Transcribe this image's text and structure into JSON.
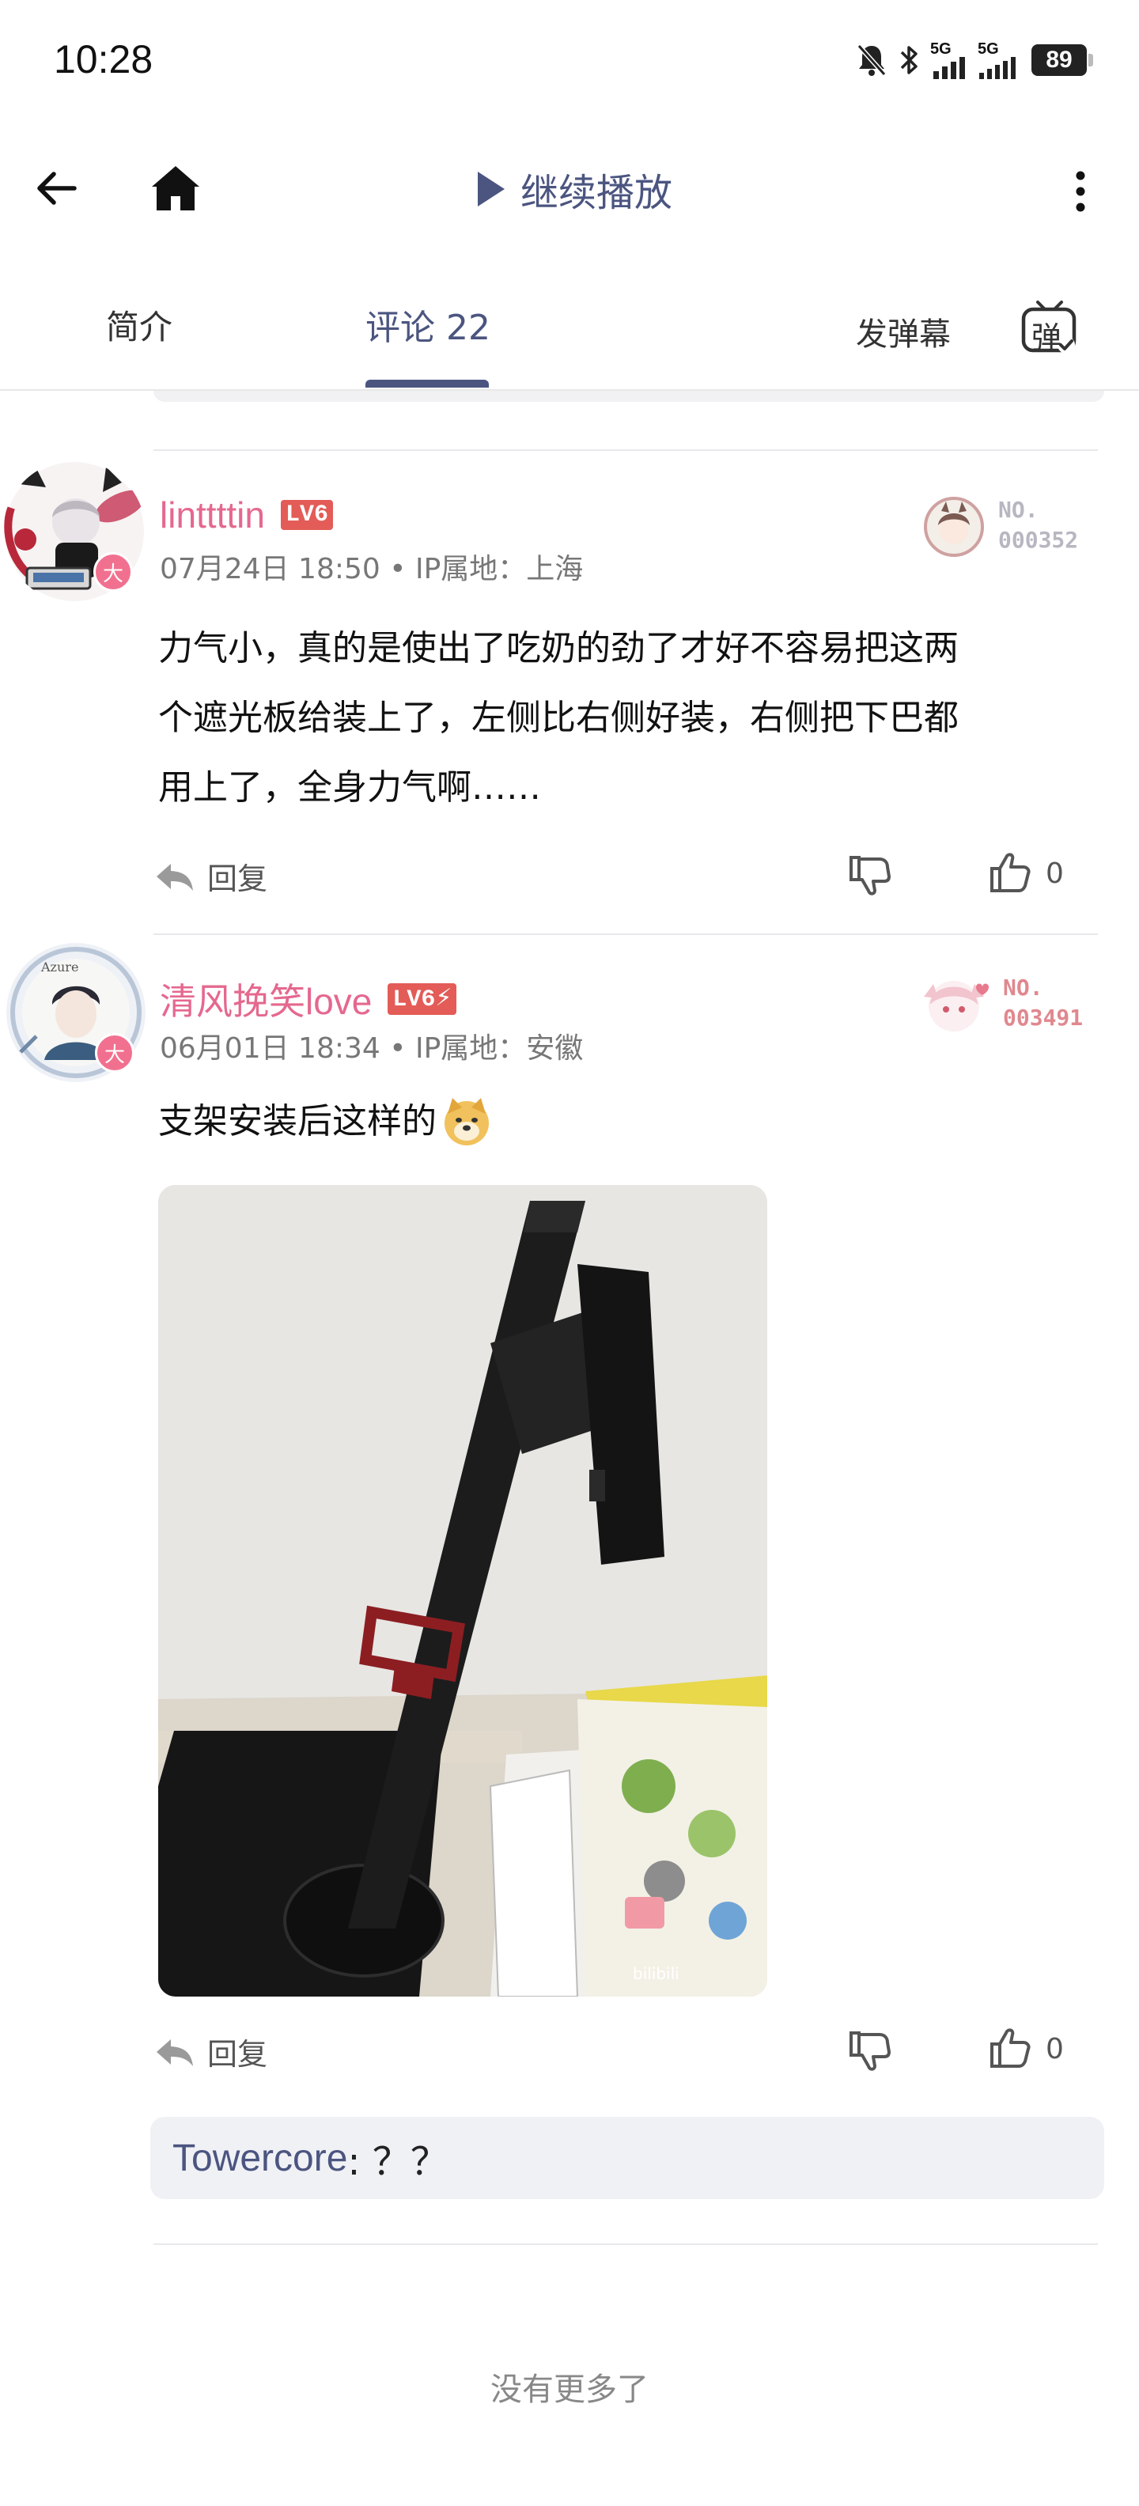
{
  "status_bar": {
    "time": "10:28",
    "network_1": "5G",
    "network_2": "5G",
    "battery": "89"
  },
  "nav": {
    "continue_label": "继续播放"
  },
  "tabs": {
    "intro": "简介",
    "comments": "评论 22",
    "send_danmaku": "发弹幕",
    "danmaku_icon_char": "弹"
  },
  "comments": [
    {
      "username": "linttttin",
      "level": "LV6",
      "date": "07月24日 18:50",
      "ip": "IP属地：上海",
      "text_lines": [
        "力气小，真的是使出了吃奶的劲了才好不容易把这两",
        "个遮光板给装上了，左侧比右侧好装，右侧把下巴都",
        "用上了，全身力气啊……"
      ],
      "fan_no_label": "NO.",
      "fan_no_value": "000352",
      "fan_color": "#b7b7c2",
      "reply_label": "回复",
      "likes": "0",
      "vip_char": "大"
    },
    {
      "username": "清风挽笑love",
      "level": "LV6",
      "date": "06月01日 18:34",
      "ip": "IP属地：安徽",
      "text": "支架安装后这样的",
      "fan_no_label": "NO.",
      "fan_no_value": "003491",
      "fan_color": "#e0888f",
      "reply_label": "回复",
      "likes": "0",
      "vip_char": "大",
      "photo_watermark": "bilibili"
    }
  ],
  "reply_preview": {
    "user": "Towercore",
    "text": ": ？？"
  },
  "footer": {
    "no_more": "没有更多了"
  },
  "colors": {
    "accent": "#4b5580",
    "username": "#e5688e",
    "level": "#e35c57"
  }
}
